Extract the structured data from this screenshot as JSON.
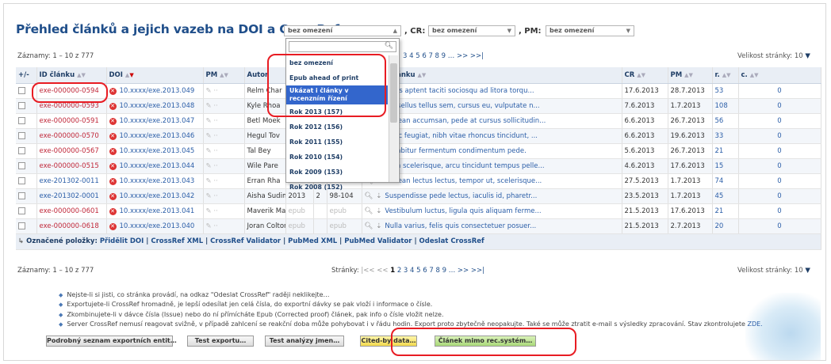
{
  "title": "Přehled článků a jejich vazeb na DOI a CrossRef",
  "filters": {
    "year_value": "bez omezení",
    "cr_label": ", CR:",
    "cr_value": "bez omezení",
    "pm_label": ", PM:",
    "pm_value": "bez omezení"
  },
  "year_dropdown": {
    "options": [
      "bez omezení",
      "Epub ahead of print",
      "Ukázat i články v recenzním řízení",
      "Rok 2013 (157)",
      "Rok 2012 (156)",
      "Rok 2011 (155)",
      "Rok 2010 (154)",
      "Rok 2009 (153)",
      "Rok 2008 (152)"
    ],
    "selected": "Ukázat i články v recenzním řízení"
  },
  "records_top": "Záznamy: 1 – 10 z 777",
  "pager_top": "3 4 5 6 7 8 9 … >> >>|",
  "pagesize_label": "Velikost stránky:",
  "pagesize_value": "10",
  "columns": [
    "+/-",
    "ID článku",
    "DOI",
    "PM",
    "Autor",
    "",
    "",
    "",
    "Jméno článku",
    "CR",
    "PM",
    "r.",
    "c."
  ],
  "rows": [
    {
      "id": "exe-000000-0594",
      "id_color": "red",
      "doi": "10.xxxx/exe.2013.049",
      "author": "Relm Char",
      "y": "",
      "v": "",
      "p": "",
      "name": "Class aptent taciti sociosqu ad litora torqu...",
      "cr": "17.6.2013",
      "pm": "28.7.2013",
      "r": "53",
      "c": "0"
    },
    {
      "id": "exe-000000-0593",
      "id_color": "red",
      "doi": "10.xxxx/exe.2013.048",
      "author": "Kyle Rhoa",
      "y": "",
      "v": "",
      "p": "",
      "name": "Phasellus tellus sem, cursus eu, vulputate n...",
      "cr": "7.6.2013",
      "pm": "1.7.2013",
      "r": "108",
      "c": "0"
    },
    {
      "id": "exe-000000-0591",
      "id_color": "red",
      "doi": "10.xxxx/exe.2013.047",
      "author": "Betl Moek",
      "y": "",
      "v": "",
      "p": "",
      "name": "Aenean accumsan, pede at cursus sollicitudin...",
      "cr": "6.6.2013",
      "pm": "26.7.2013",
      "r": "56",
      "c": "0"
    },
    {
      "id": "exe-000000-0570",
      "id_color": "red",
      "doi": "10.xxxx/exe.2013.046",
      "author": "Hegul Tov",
      "y": "",
      "v": "",
      "p": "",
      "name": "Nunc feugiat, nibh vitae rhoncus tincidunt, ...",
      "cr": "6.6.2013",
      "pm": "19.6.2013",
      "r": "33",
      "c": "0"
    },
    {
      "id": "exe-000000-0567",
      "id_color": "red",
      "doi": "10.xxxx/exe.2013.045",
      "author": "Tal Bey",
      "y": "",
      "v": "",
      "p": "",
      "name": "Curabitur fermentum condimentum pede.",
      "cr": "5.6.2013",
      "pm": "26.7.2013",
      "r": "21",
      "c": "0"
    },
    {
      "id": "exe-000000-0515",
      "id_color": "red",
      "doi": "10.xxxx/exe.2013.044",
      "author": "Wile Pare",
      "y": "",
      "v": "",
      "p": "",
      "name": "Nam scelerisque, arcu tincidunt tempus pelle...",
      "cr": "4.6.2013",
      "pm": "17.6.2013",
      "r": "15",
      "c": "0"
    },
    {
      "id": "exe-201302-0011",
      "id_color": "blue",
      "doi": "10.xxxx/exe.2013.043",
      "author": "Erran Rha",
      "y": "",
      "v": "",
      "p": "",
      "name": "Aenean lectus lectus, tempor ut, scelerisque...",
      "cr": "27.5.2013",
      "pm": "1.7.2013",
      "r": "74",
      "c": "0"
    },
    {
      "id": "exe-201302-0001",
      "id_color": "blue",
      "doi": "10.xxxx/exe.2013.042",
      "author": "Aisha Sudime",
      "y": "2013",
      "v": "2",
      "p": "98-104",
      "name": "Suspendisse pede lectus, iaculis id, pharetr...",
      "cr": "23.5.2013",
      "pm": "1.7.2013",
      "r": "45",
      "c": "0"
    },
    {
      "id": "exe-000000-0601",
      "id_color": "red",
      "doi": "10.xxxx/exe.2013.041",
      "author": "Maverik Maru",
      "y": "epub",
      "v": "",
      "p": "epub",
      "name": "Vestibulum luctus, ligula quis aliquam ferme...",
      "cr": "21.5.2013",
      "pm": "17.6.2013",
      "r": "21",
      "c": "0"
    },
    {
      "id": "exe-000000-0618",
      "id_color": "red",
      "doi": "10.xxxx/exe.2013.040",
      "author": "Joran Colton",
      "y": "epub",
      "v": "",
      "p": "epub",
      "name": "Nulla varius, felis quis consectetuer posuer...",
      "cr": "21.5.2013",
      "pm": "2.7.2013",
      "r": "20",
      "c": "0"
    }
  ],
  "footer": {
    "label": "Označené položky:",
    "actions": [
      "Přidělit DOI",
      "CrossRef XML",
      "CrossRef Validator",
      "PubMed XML",
      "PubMed Validator",
      "Odeslat CrossRef"
    ]
  },
  "records_bottom": "Záznamy: 1 – 10 z 777",
  "pager_bottom_label": "Stránky:",
  "pager_bottom_first": "|<< <<",
  "pager_bottom_current": "1",
  "pager_bottom_rest": "2 3 4 5 6 7 8 9 … >> >>|",
  "notes": [
    "Nejste-li si jisti, co stránka provádí, na odkaz \"Odeslat CrossRef\" raději neklikejte…",
    "Exportujete-li CrossRef hromadně, je lepší odesílat jen celá čísla, do exportní dávky se pak vloží i informace o čísle.",
    "Zkombinujete-li v dávce čísla (Issue) nebo do ní přímícháte Epub (Corrected proof) článek, pak info o čísle vložit nelze.",
    "Server CrossRef nemusí reagovat svižně, v případě zahlcení se reakční doba může pohybovat i v řádu hodin. Export proto zbytečně neopakujte. Také se může ztratit e-mail s výsledky zpracování. Stav zkontrolujete"
  ],
  "notes_link": "ZDE.",
  "buttons": [
    "Podrobný seznam exportních entit…",
    "Test exportu…",
    "Test analýzy jmen…",
    "Cited-by data…",
    "Článek mimo rec.systém…"
  ]
}
